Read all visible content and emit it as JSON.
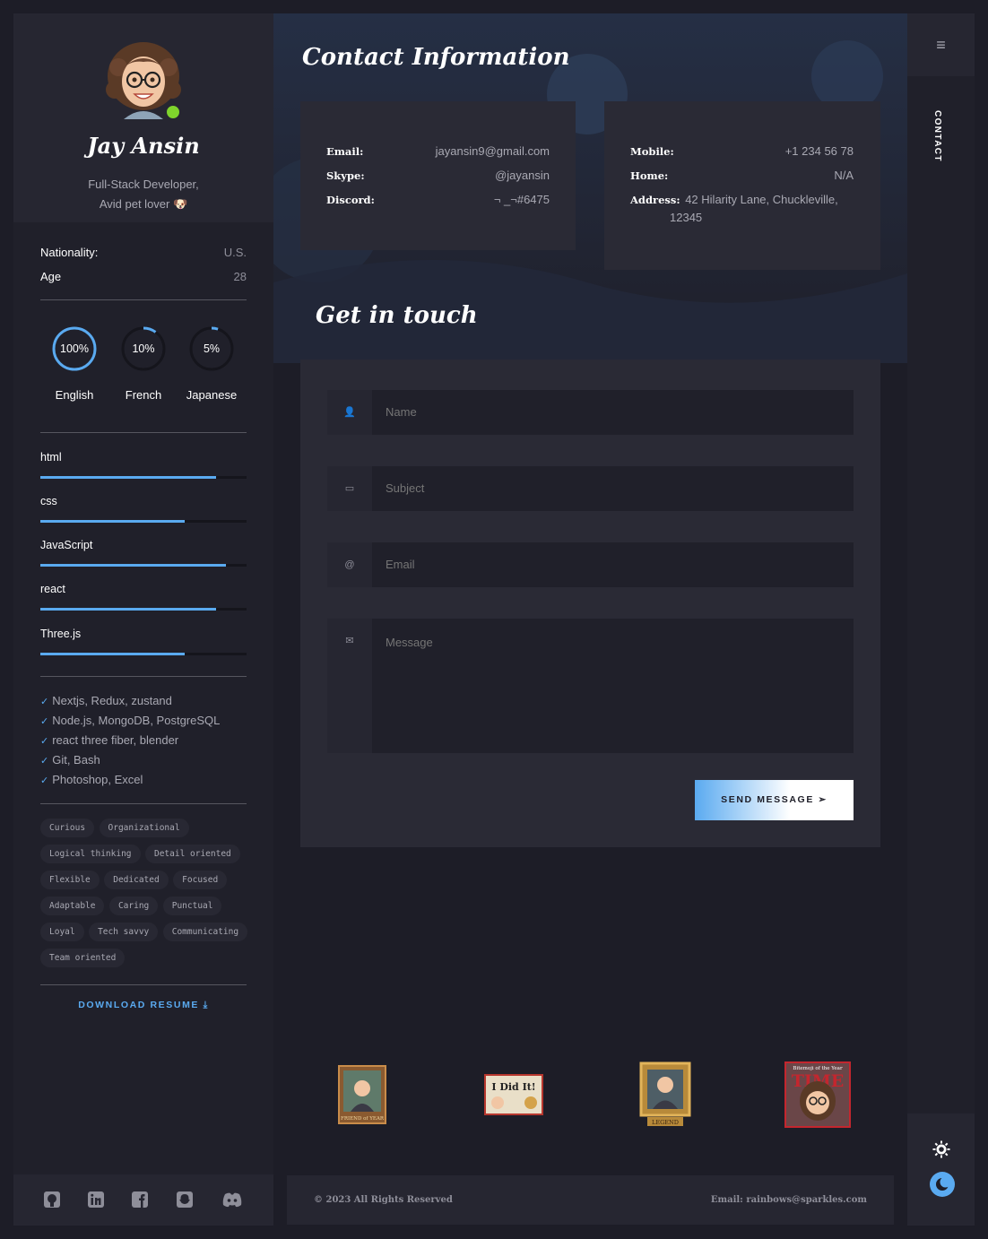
{
  "profile": {
    "name": "Jay Ansin",
    "role_line1": "Full-Stack Developer,",
    "role_line2": "Avid pet lover 🐶"
  },
  "info": [
    {
      "label": "Nationality:",
      "value": "U.S."
    },
    {
      "label": "Age",
      "value": "28"
    }
  ],
  "languages": [
    {
      "name": "English",
      "percent": "100%",
      "level": 1.0
    },
    {
      "name": "French",
      "percent": "10%",
      "level": 0.1
    },
    {
      "name": "Japanese",
      "percent": "5%",
      "level": 0.05
    }
  ],
  "skills": [
    {
      "name": "html",
      "level": 0.85
    },
    {
      "name": "css",
      "level": 0.7
    },
    {
      "name": "JavaScript",
      "level": 0.9
    },
    {
      "name": "react",
      "level": 0.85
    },
    {
      "name": "Three.js",
      "level": 0.7
    }
  ],
  "extra_skills": [
    "Nextjs, Redux, zustand",
    "Node.js, MongoDB, PostgreSQL",
    "react three fiber, blender",
    "Git, Bash",
    "Photoshop, Excel"
  ],
  "traits": [
    "Curious",
    "Organizational",
    "Logical thinking",
    "Detail oriented",
    "Flexible",
    "Dedicated",
    "Focused",
    "Adaptable",
    "Caring",
    "Punctual",
    "Loyal",
    "Tech savvy",
    "Communicating",
    "Team oriented"
  ],
  "download_label": "DOWNLOAD RESUME",
  "social_icons": [
    "github-icon",
    "linkedin-icon",
    "facebook-icon",
    "snapchat-icon",
    "discord-icon"
  ],
  "contact": {
    "title": "Contact Information",
    "left": [
      {
        "label": "Email:",
        "value": "jayansin9@gmail.com"
      },
      {
        "label": "Skype:",
        "value": "@jayansin"
      },
      {
        "label": "Discord:",
        "value": "¬ _¬#6475"
      }
    ],
    "right": [
      {
        "label": "Mobile:",
        "value": "+1 234 56 78"
      },
      {
        "label": "Home:",
        "value": "N/A"
      },
      {
        "label": "Address:",
        "value": "42 Hilarity Lane, Chuckleville,",
        "value2": "12345"
      }
    ]
  },
  "form": {
    "title": "Get in touch",
    "name_placeholder": "Name",
    "subject_placeholder": "Subject",
    "email_placeholder": "Email",
    "message_placeholder": "Message",
    "send_label": "SEND MESSAGE"
  },
  "badges": [
    {
      "caption": "FRIEND of YEAR"
    },
    {
      "caption": "I Did It!"
    },
    {
      "caption": "LEGEND"
    },
    {
      "caption": "TIME",
      "top_text": "Bitemoji of the Year"
    }
  ],
  "footer": {
    "copyright": "© 2023 All Rights Reserved",
    "email": "Email: rainbows@sparkles.com"
  },
  "nav": {
    "section_label": "CONTACT"
  },
  "colors": {
    "accent": "#5aaaf0",
    "online": "#7fd42c",
    "background": "#1d1d27",
    "panel": "#2a2a35"
  }
}
